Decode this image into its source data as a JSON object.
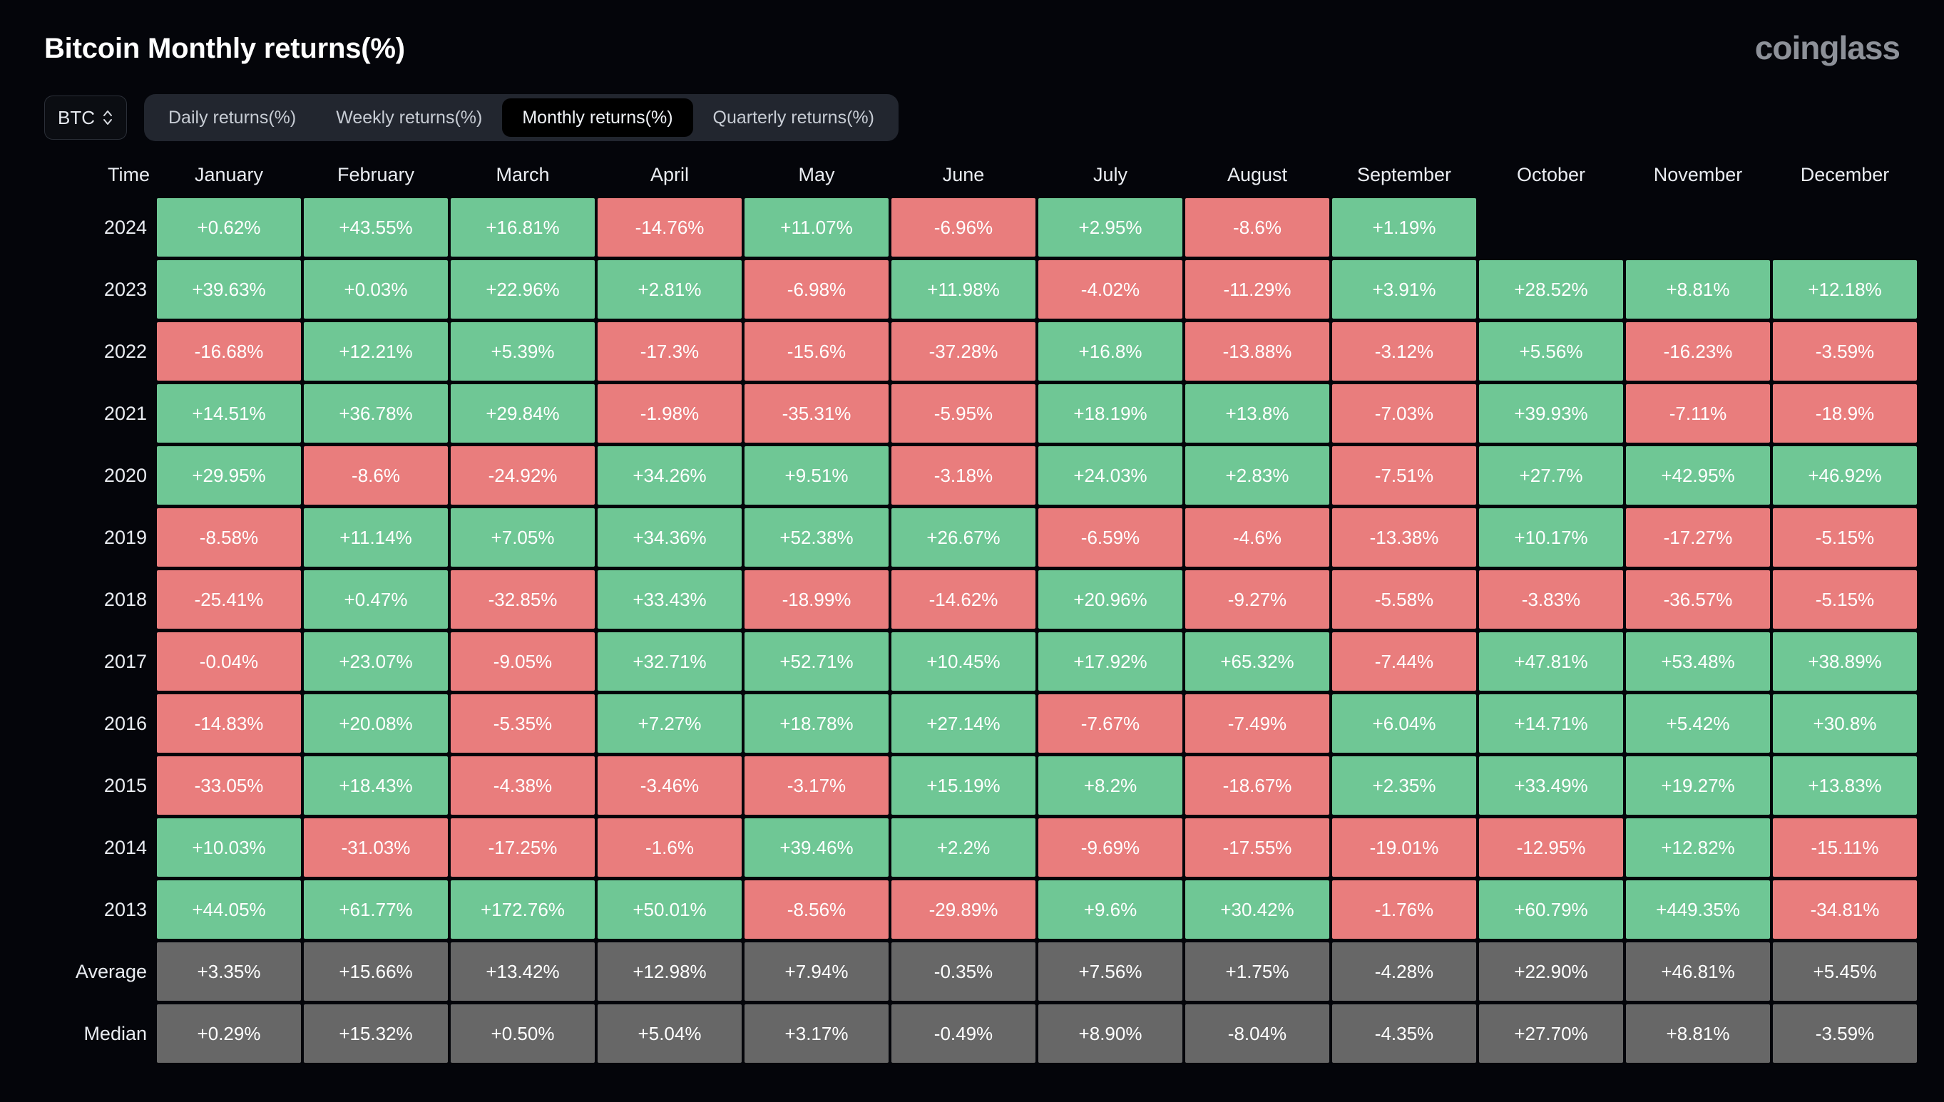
{
  "header": {
    "title": "Bitcoin Monthly returns(%)",
    "brand": "coinglass"
  },
  "controls": {
    "symbol": "BTC",
    "symbol_icon": "chevron-up-down-icon",
    "tabs": [
      {
        "label": "Daily returns(%)",
        "active": false
      },
      {
        "label": "Weekly returns(%)",
        "active": false
      },
      {
        "label": "Monthly returns(%)",
        "active": true
      },
      {
        "label": "Quarterly returns(%)",
        "active": false
      }
    ]
  },
  "colors": {
    "positive": "#6fc795",
    "negative": "#e97d7d",
    "neutral": "#676767",
    "background": "#04050a",
    "text": "#ffffff",
    "brand": "#8d9199"
  },
  "table": {
    "columns": [
      "Time",
      "January",
      "February",
      "March",
      "April",
      "May",
      "June",
      "July",
      "August",
      "September",
      "October",
      "November",
      "December"
    ],
    "rows": [
      {
        "label": "2024",
        "type": "year",
        "values": [
          "+0.62%",
          "+43.55%",
          "+16.81%",
          "-14.76%",
          "+11.07%",
          "-6.96%",
          "+2.95%",
          "-8.6%",
          "+1.19%",
          "",
          "",
          ""
        ]
      },
      {
        "label": "2023",
        "type": "year",
        "values": [
          "+39.63%",
          "+0.03%",
          "+22.96%",
          "+2.81%",
          "-6.98%",
          "+11.98%",
          "-4.02%",
          "-11.29%",
          "+3.91%",
          "+28.52%",
          "+8.81%",
          "+12.18%"
        ]
      },
      {
        "label": "2022",
        "type": "year",
        "values": [
          "-16.68%",
          "+12.21%",
          "+5.39%",
          "-17.3%",
          "-15.6%",
          "-37.28%",
          "+16.8%",
          "-13.88%",
          "-3.12%",
          "+5.56%",
          "-16.23%",
          "-3.59%"
        ]
      },
      {
        "label": "2021",
        "type": "year",
        "values": [
          "+14.51%",
          "+36.78%",
          "+29.84%",
          "-1.98%",
          "-35.31%",
          "-5.95%",
          "+18.19%",
          "+13.8%",
          "-7.03%",
          "+39.93%",
          "-7.11%",
          "-18.9%"
        ]
      },
      {
        "label": "2020",
        "type": "year",
        "values": [
          "+29.95%",
          "-8.6%",
          "-24.92%",
          "+34.26%",
          "+9.51%",
          "-3.18%",
          "+24.03%",
          "+2.83%",
          "-7.51%",
          "+27.7%",
          "+42.95%",
          "+46.92%"
        ]
      },
      {
        "label": "2019",
        "type": "year",
        "values": [
          "-8.58%",
          "+11.14%",
          "+7.05%",
          "+34.36%",
          "+52.38%",
          "+26.67%",
          "-6.59%",
          "-4.6%",
          "-13.38%",
          "+10.17%",
          "-17.27%",
          "-5.15%"
        ]
      },
      {
        "label": "2018",
        "type": "year",
        "values": [
          "-25.41%",
          "+0.47%",
          "-32.85%",
          "+33.43%",
          "-18.99%",
          "-14.62%",
          "+20.96%",
          "-9.27%",
          "-5.58%",
          "-3.83%",
          "-36.57%",
          "-5.15%"
        ]
      },
      {
        "label": "2017",
        "type": "year",
        "values": [
          "-0.04%",
          "+23.07%",
          "-9.05%",
          "+32.71%",
          "+52.71%",
          "+10.45%",
          "+17.92%",
          "+65.32%",
          "-7.44%",
          "+47.81%",
          "+53.48%",
          "+38.89%"
        ]
      },
      {
        "label": "2016",
        "type": "year",
        "values": [
          "-14.83%",
          "+20.08%",
          "-5.35%",
          "+7.27%",
          "+18.78%",
          "+27.14%",
          "-7.67%",
          "-7.49%",
          "+6.04%",
          "+14.71%",
          "+5.42%",
          "+30.8%"
        ]
      },
      {
        "label": "2015",
        "type": "year",
        "values": [
          "-33.05%",
          "+18.43%",
          "-4.38%",
          "-3.46%",
          "-3.17%",
          "+15.19%",
          "+8.2%",
          "-18.67%",
          "+2.35%",
          "+33.49%",
          "+19.27%",
          "+13.83%"
        ]
      },
      {
        "label": "2014",
        "type": "year",
        "values": [
          "+10.03%",
          "-31.03%",
          "-17.25%",
          "-1.6%",
          "+39.46%",
          "+2.2%",
          "-9.69%",
          "-17.55%",
          "-19.01%",
          "-12.95%",
          "+12.82%",
          "-15.11%"
        ]
      },
      {
        "label": "2013",
        "type": "year",
        "values": [
          "+44.05%",
          "+61.77%",
          "+172.76%",
          "+50.01%",
          "-8.56%",
          "-29.89%",
          "+9.6%",
          "+30.42%",
          "-1.76%",
          "+60.79%",
          "+449.35%",
          "-34.81%"
        ]
      },
      {
        "label": "Average",
        "type": "summary",
        "values": [
          "+3.35%",
          "+15.66%",
          "+13.42%",
          "+12.98%",
          "+7.94%",
          "-0.35%",
          "+7.56%",
          "+1.75%",
          "-4.28%",
          "+22.90%",
          "+46.81%",
          "+5.45%"
        ]
      },
      {
        "label": "Median",
        "type": "summary",
        "values": [
          "+0.29%",
          "+15.32%",
          "+0.50%",
          "+5.04%",
          "+3.17%",
          "-0.49%",
          "+8.90%",
          "-8.04%",
          "-4.35%",
          "+27.70%",
          "+8.81%",
          "-3.59%"
        ]
      }
    ]
  }
}
